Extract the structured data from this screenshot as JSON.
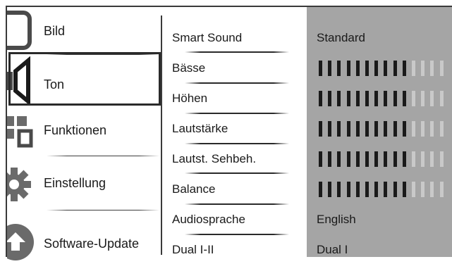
{
  "menu": {
    "items": [
      {
        "label": "Bild",
        "icon": "picture-icon"
      },
      {
        "label": "Ton",
        "icon": "speaker-icon",
        "selected": true
      },
      {
        "label": "Funktionen",
        "icon": "features-icon"
      },
      {
        "label": "Einstellung",
        "icon": "gear-icon"
      },
      {
        "label": "Software-Update",
        "icon": "upload-icon"
      }
    ]
  },
  "submenu": {
    "items": [
      {
        "label": "Smart Sound"
      },
      {
        "label": "Bässe"
      },
      {
        "label": "Höhen"
      },
      {
        "label": "Lautstärke"
      },
      {
        "label": "Lautst. Sehbeh."
      },
      {
        "label": "Balance"
      },
      {
        "label": "Audiosprache"
      },
      {
        "label": "Dual I-II"
      }
    ]
  },
  "values": {
    "smart_sound": "Standard",
    "bars": [
      {
        "name": "bass-level-bar",
        "filled": 10,
        "total": 14
      },
      {
        "name": "treble-level-bar",
        "filled": 10,
        "total": 14
      },
      {
        "name": "volume-level-bar",
        "filled": 10,
        "total": 14
      },
      {
        "name": "visually-impaired-volume-bar",
        "filled": 10,
        "total": 14
      },
      {
        "name": "balance-level-bar",
        "filled": 10,
        "total": 14
      }
    ],
    "audio_language": "English",
    "dual": "Dual I"
  },
  "colors": {
    "panel_gray": "#a5a5a5",
    "bar_filled": "#1a1a1a",
    "bar_empty": "#c9c9c9"
  }
}
